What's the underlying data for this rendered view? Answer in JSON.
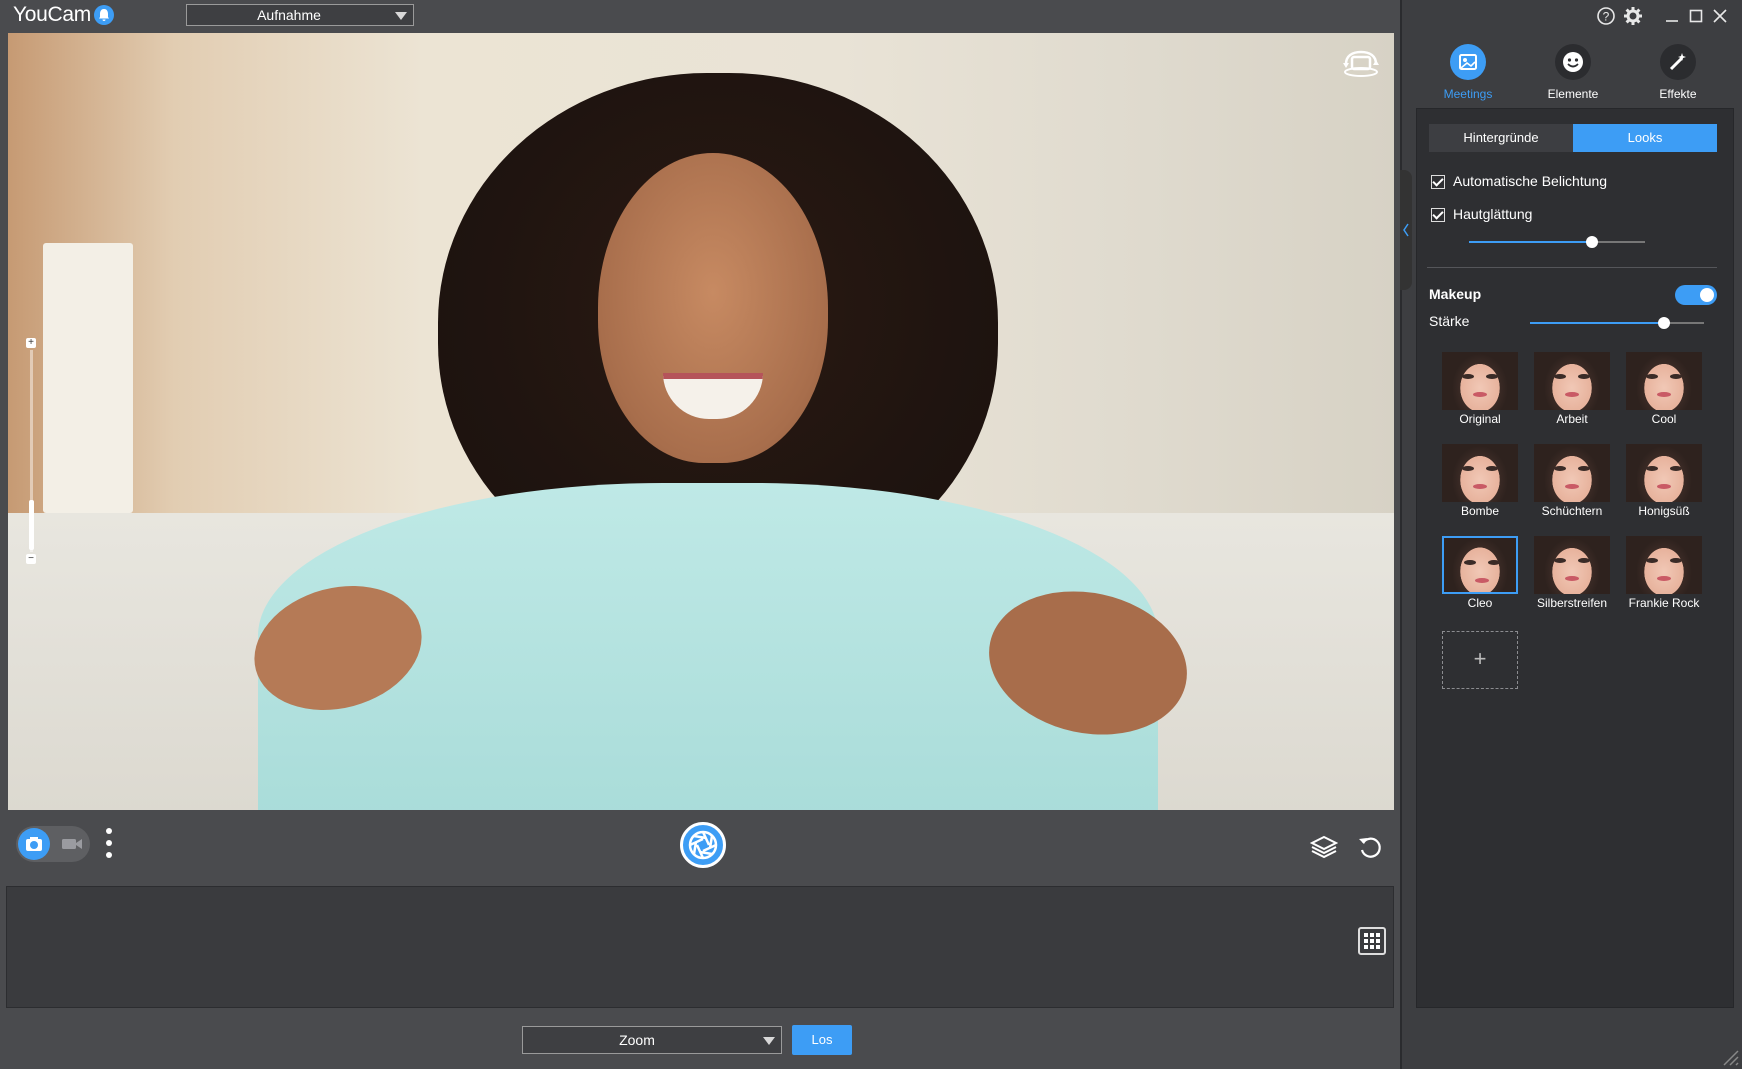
{
  "app": {
    "title": "YouCam"
  },
  "topbar": {
    "mode_select": "Aufnahme"
  },
  "window_controls": {
    "help": "?",
    "minimize": "—",
    "maximize": "☐",
    "close": "✕"
  },
  "tabs": [
    {
      "label": "Meetings",
      "icon": "meetings-icon",
      "active": true
    },
    {
      "label": "Elemente",
      "icon": "elemente-icon",
      "active": false
    },
    {
      "label": "Effekte",
      "icon": "effekte-icon",
      "active": false
    }
  ],
  "segments": {
    "left": "Hintergründe",
    "right": "Looks",
    "active": "Looks"
  },
  "options": {
    "auto_exposure": {
      "label": "Automatische Belichtung",
      "checked": true
    },
    "skin_smoothing": {
      "label": "Hautglättung",
      "checked": true,
      "level": 0.7
    }
  },
  "makeup": {
    "title": "Makeup",
    "enabled": true,
    "strength_label": "Stärke",
    "strength": 0.77
  },
  "looks": [
    {
      "name": "Original"
    },
    {
      "name": "Arbeit"
    },
    {
      "name": "Cool"
    },
    {
      "name": "Bombe"
    },
    {
      "name": "Schüchtern"
    },
    {
      "name": "Honigsüß"
    },
    {
      "name": "Cleo",
      "selected": true
    },
    {
      "name": "Silberstreifen"
    },
    {
      "name": "Frankie Rock"
    }
  ],
  "add_look": "+",
  "bottom": {
    "app_select": "Zoom",
    "go_label": "Los"
  },
  "zoom_slider": {
    "plus": "+",
    "minus": "−",
    "level": 0.25
  },
  "colors": {
    "accent": "#3d9df5",
    "background": "#4a4b4e",
    "panel": "#2e2f32"
  }
}
